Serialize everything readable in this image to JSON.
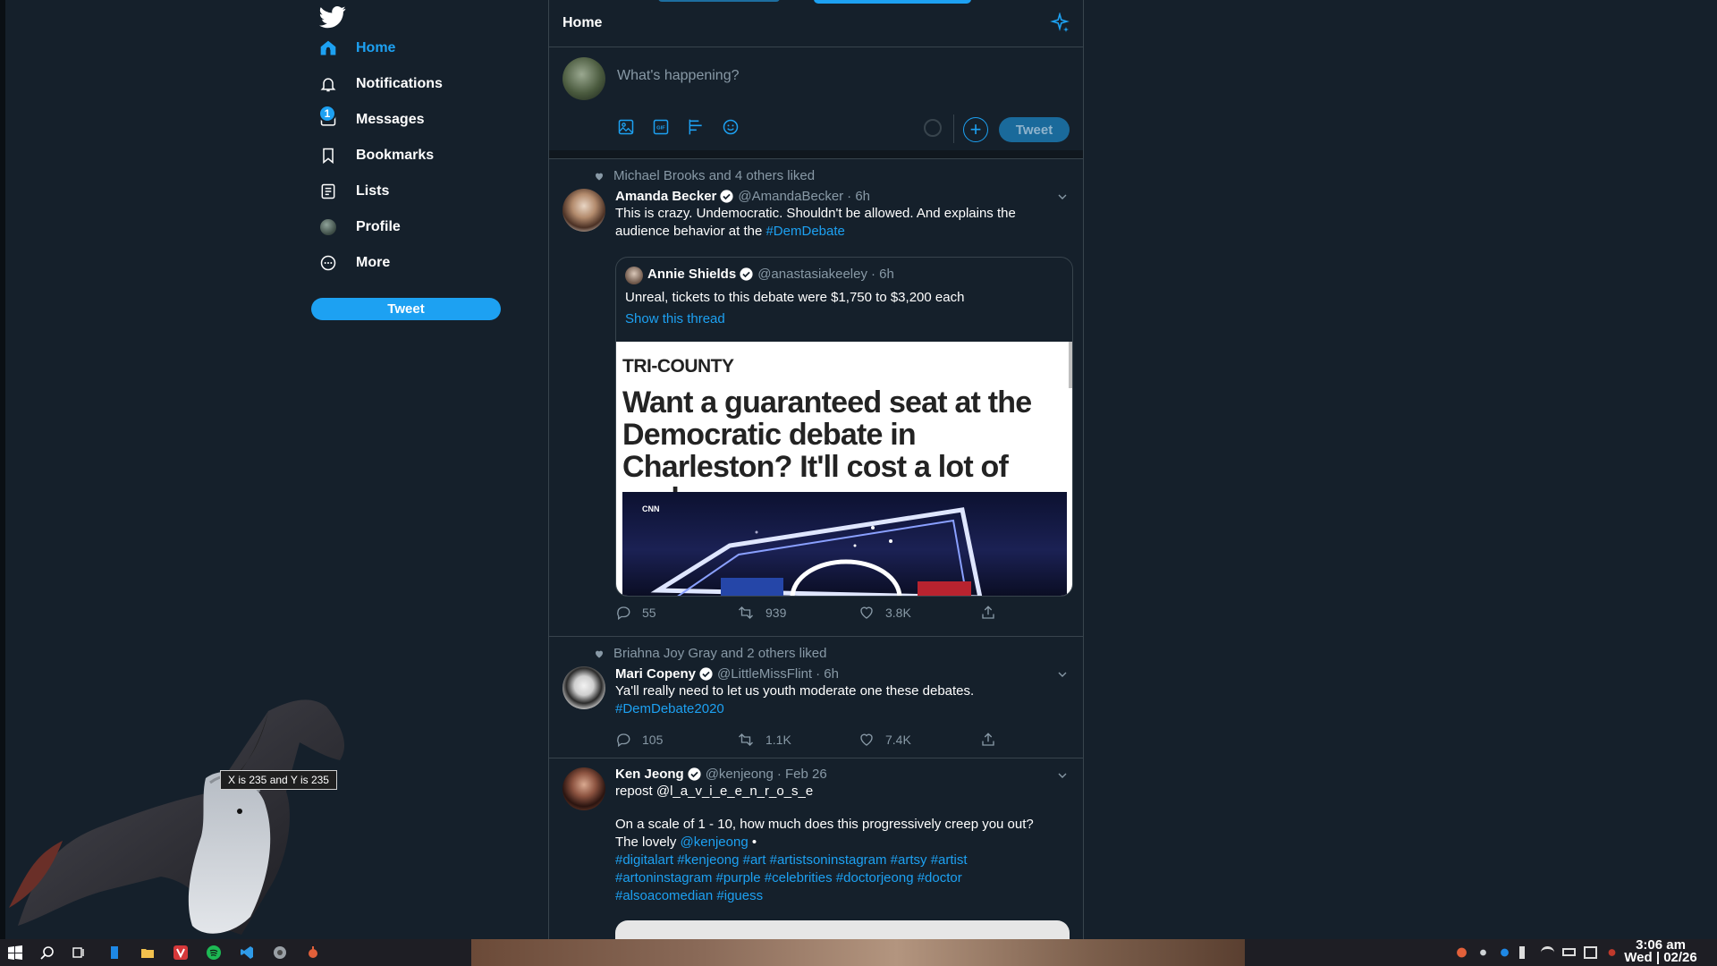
{
  "sidebar": {
    "nav": [
      {
        "label": "Home",
        "icon": "home-icon",
        "active": true
      },
      {
        "label": "Notifications",
        "icon": "bell-icon",
        "active": false
      },
      {
        "label": "Messages",
        "icon": "mail-icon",
        "active": false,
        "badge": "1"
      },
      {
        "label": "Bookmarks",
        "icon": "bookmark-icon",
        "active": false
      },
      {
        "label": "Lists",
        "icon": "list-icon",
        "active": false
      },
      {
        "label": "Profile",
        "icon": "profile-avatar-icon",
        "active": false
      },
      {
        "label": "More",
        "icon": "more-icon",
        "active": false
      }
    ],
    "tweet_button": "Tweet"
  },
  "header": {
    "title": "Home"
  },
  "compose": {
    "placeholder": "What's happening?",
    "tweet_button": "Tweet"
  },
  "tweets": [
    {
      "social": "Michael Brooks and 4 others liked",
      "name": "Amanda Becker",
      "handle": "@AmandaBecker",
      "time": "· 6h",
      "text": "This is crazy. Undemocratic. Shouldn't be allowed. And explains the audience behavior at the",
      "hashtag": "#DemDebate",
      "quote": {
        "name": "Annie Shields",
        "handle": "@anastasiakeeley",
        "time": "· 6h",
        "text": "Unreal, tickets to this debate were $1,750 to $3,200 each",
        "link": "Show this thread",
        "image_source": "TRI-COUNTY",
        "image_headline": "Want a guaranteed seat at the Democratic debate in Charleston? It'll cost a lot of cash.",
        "image_logo": "CNN"
      },
      "replies": "55",
      "retweets": "939",
      "likes": "3.8K"
    },
    {
      "social": "Briahna Joy Gray and 2 others liked",
      "name": "Mari Copeny",
      "handle": "@LittleMissFlint",
      "time": "· 6h",
      "text": "Ya'll really need to let us youth moderate one these debates.",
      "hashtag": "#DemDebate2020",
      "replies": "105",
      "retweets": "1.1K",
      "likes": "7.4K"
    },
    {
      "name": "Ken Jeong",
      "handle": "@kenjeong",
      "time": "· Feb 26",
      "line1": "repost @l_a_v_i_e_e_n_r_o_s_e",
      "line2": "On a scale of 1 - 10, how much does this progressively creep you out?",
      "line3_prefix": "The lovely",
      "line3_mention": "@kenjeong",
      "line3_suffix": "•",
      "hashtags1": "#digitalart #kenjeong #art #artistsoninstagram #artsy #artist",
      "hashtags2": "#artoninstagram #purple #celebrities #doctorjeong #doctor",
      "hashtags3": "#alsoacomedian #iguess"
    }
  ],
  "desktop": {
    "tooltip": "X is 235 and Y is 235"
  },
  "taskbar": {
    "time": "3:06 am",
    "date": "Wed | 02/26"
  },
  "colors": {
    "accent": "#1da1f2",
    "background": "#15202b",
    "border": "#38444d",
    "secondary_text": "#8899a6"
  }
}
